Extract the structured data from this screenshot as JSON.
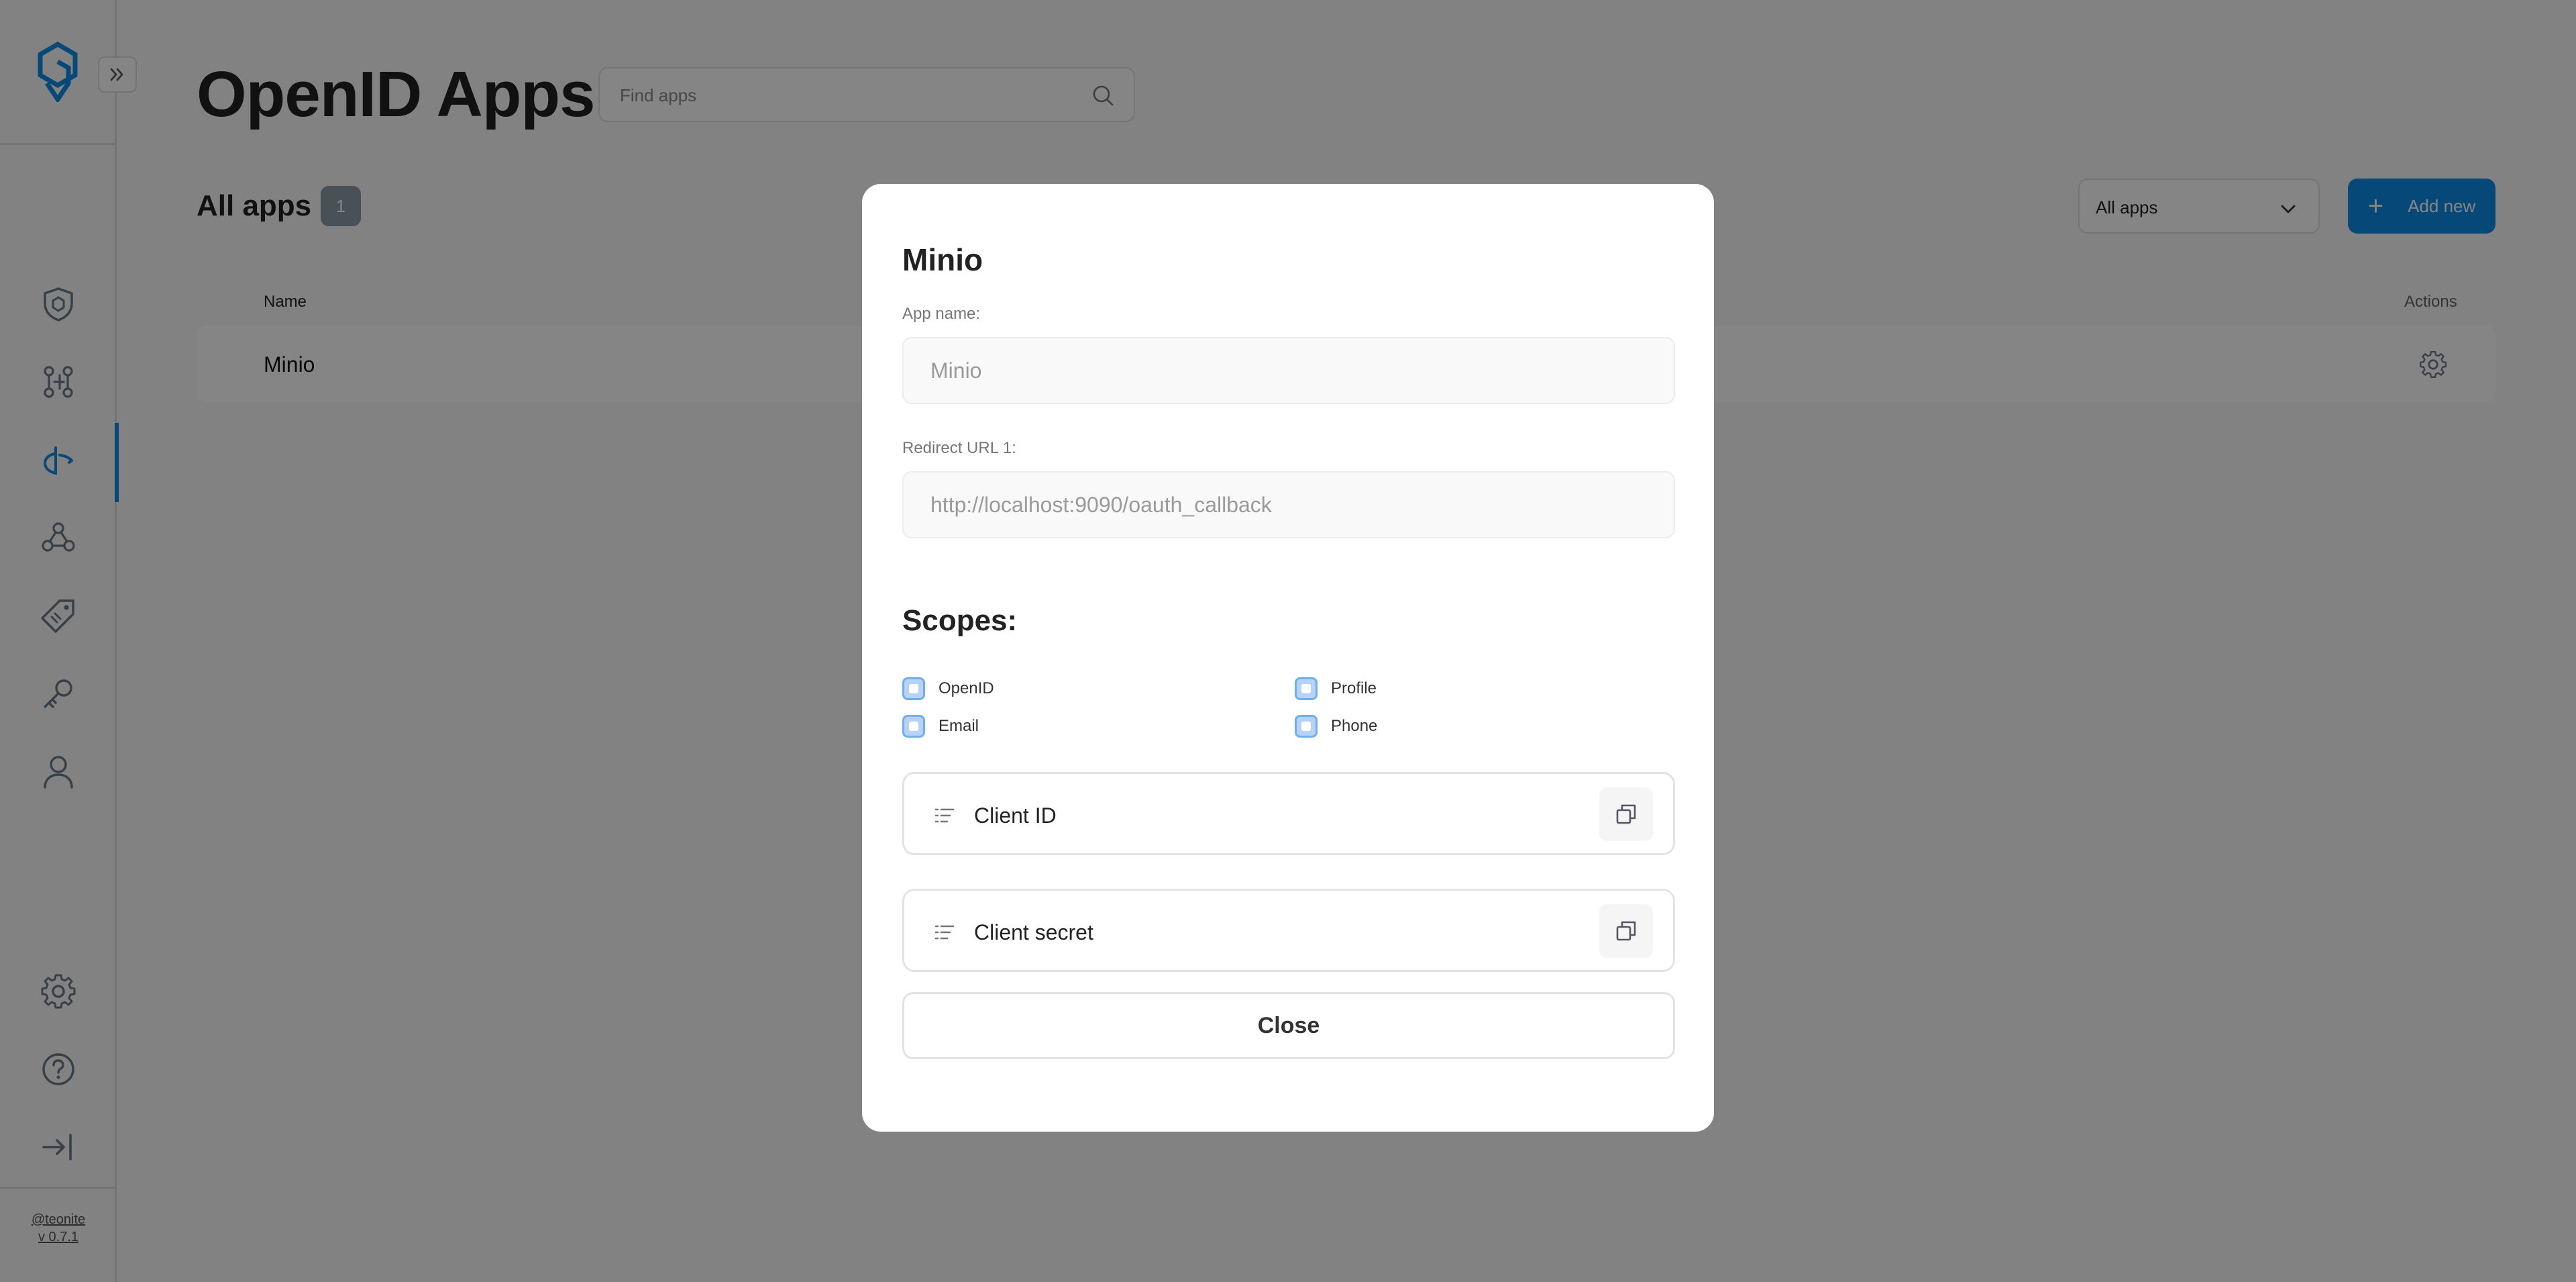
{
  "sidebar": {
    "version_owner": "@teonite",
    "version_number": "v 0.7.1",
    "items": [
      {
        "icon": "shield-icon"
      },
      {
        "icon": "users-grid-icon"
      },
      {
        "icon": "openid-icon",
        "active": true
      },
      {
        "icon": "webhooks-icon"
      },
      {
        "icon": "tag-icon"
      },
      {
        "icon": "key-icon"
      },
      {
        "icon": "user-icon"
      }
    ],
    "bottom_items": [
      {
        "icon": "gear-icon"
      },
      {
        "icon": "help-icon"
      },
      {
        "icon": "logout-icon"
      }
    ]
  },
  "header": {
    "title": "OpenID Apps",
    "search_placeholder": "Find apps"
  },
  "list": {
    "title": "All apps",
    "count": "1",
    "filter_value": "All apps",
    "add_label": "Add new",
    "columns": {
      "name": "Name",
      "actions": "Actions"
    },
    "rows": [
      {
        "name": "Minio"
      }
    ]
  },
  "modal": {
    "title": "Minio",
    "app_name_label": "App name:",
    "app_name_value": "Minio",
    "redirect_label": "Redirect URL 1:",
    "redirect_value": "http://localhost:9090/oauth_callback",
    "scopes_title": "Scopes:",
    "scopes": [
      {
        "label": "OpenID"
      },
      {
        "label": "Profile"
      },
      {
        "label": "Email"
      },
      {
        "label": "Phone"
      }
    ],
    "client_id_label": "Client ID",
    "client_secret_label": "Client secret",
    "close_label": "Close"
  },
  "colors": {
    "accent": "#0c8ce9",
    "badge": "#899ca8",
    "checkbox_fill": "#b4d3f6"
  }
}
